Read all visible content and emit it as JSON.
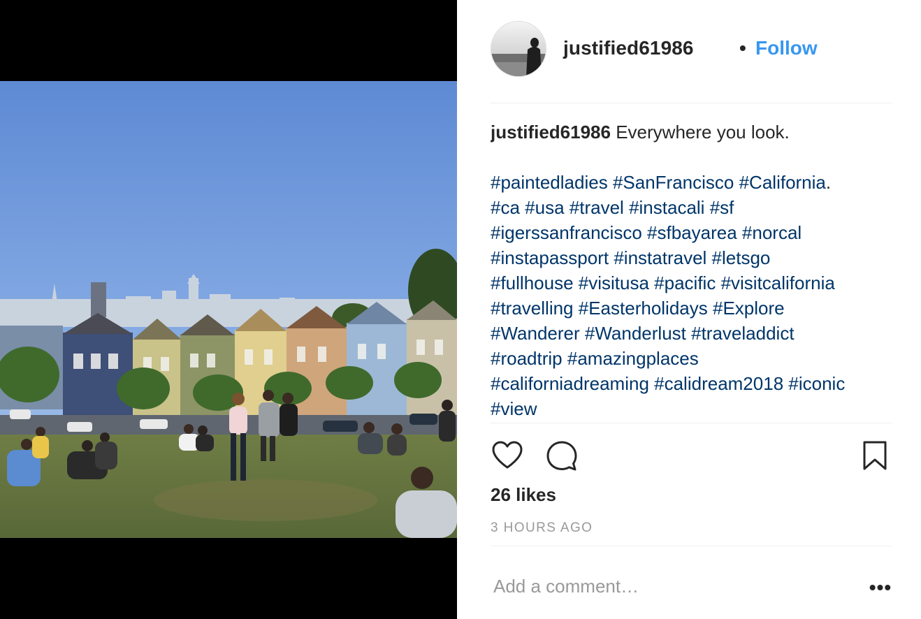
{
  "post": {
    "username": "justified61986",
    "separator": "•",
    "follow_label": "Follow",
    "caption_user": "justified61986",
    "caption_text": "Everywhere you look.",
    "hashtag_lines": [
      [
        {
          "tag": "#paintedladies"
        },
        {
          "tag": "#SanFrancisco"
        },
        {
          "tag": "#California",
          "suffix": "."
        }
      ],
      [
        {
          "tag": "#ca"
        },
        {
          "tag": "#usa"
        },
        {
          "tag": "#travel"
        },
        {
          "tag": "#instacali"
        },
        {
          "tag": "#sf"
        }
      ],
      [
        {
          "tag": "#igerssanfrancisco"
        },
        {
          "tag": "#sfbayarea"
        },
        {
          "tag": "#norcal"
        }
      ],
      [
        {
          "tag": "#instapassport"
        },
        {
          "tag": "#instatravel"
        },
        {
          "tag": "#letsgo"
        }
      ],
      [
        {
          "tag": "#fullhouse"
        },
        {
          "tag": "#visitusa"
        },
        {
          "tag": "#pacific"
        },
        {
          "tag": "#visitcalifornia"
        }
      ],
      [
        {
          "tag": "#travelling"
        },
        {
          "tag": "#Easterholidays"
        },
        {
          "tag": "#Explore"
        }
      ],
      [
        {
          "tag": "#Wanderer"
        },
        {
          "tag": "#Wanderlust"
        },
        {
          "tag": "#traveladdict"
        }
      ],
      [
        {
          "tag": "#roadtrip"
        },
        {
          "tag": "#amazingplaces"
        }
      ],
      [
        {
          "tag": "#californiadreaming"
        },
        {
          "tag": "#calidream2018"
        },
        {
          "tag": "#iconic"
        }
      ],
      [
        {
          "tag": "#view"
        }
      ]
    ],
    "likes": "26 likes",
    "timestamp": "3 HOURS AGO",
    "comment_placeholder": "Add a comment…",
    "more_label": "•••"
  },
  "icons": {
    "like": "heart-icon",
    "comment": "speech-bubble-icon",
    "save": "bookmark-icon",
    "more": "ellipsis-icon"
  },
  "colors": {
    "follow": "#3897f0",
    "hashtag": "#003569",
    "text": "#262626",
    "muted": "#999999",
    "divider": "#efefef",
    "media_background": "#000000"
  }
}
